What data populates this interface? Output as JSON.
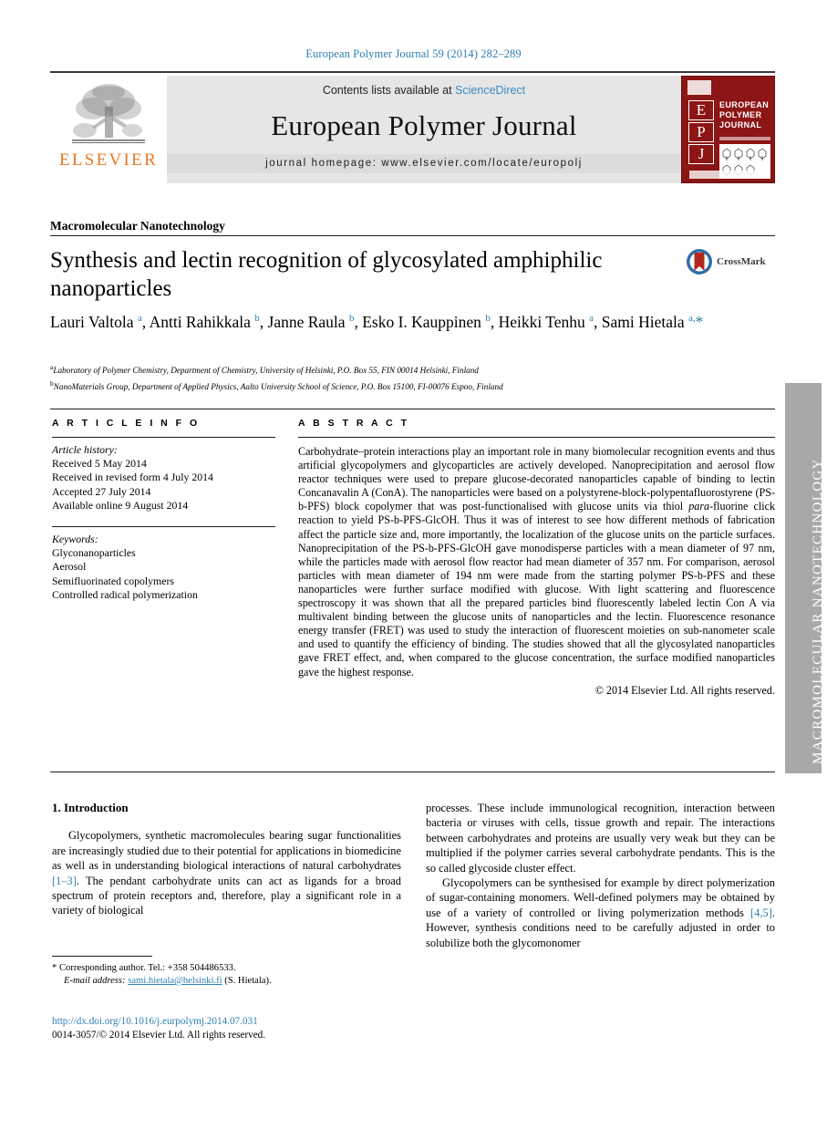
{
  "running_head": "European Polymer Journal 59 (2014) 282–289",
  "masthead": {
    "contents_prefix": "Contents lists available at ",
    "sciencedirect": "ScienceDirect",
    "journal_name": "European Polymer Journal",
    "homepage": "journal homepage: www.elsevier.com/locate/europolj",
    "publisher_wordmark": "ELSEVIER",
    "cover": {
      "letters": [
        "E",
        "P",
        "J"
      ],
      "title": "EUROPEAN POLYMER JOURNAL"
    }
  },
  "section_label": "Macromolecular Nanotechnology",
  "title": "Synthesis and lectin recognition of glycosylated amphiphilic nanoparticles",
  "crossmark_label": "CrossMark",
  "authors_html": "Lauri Valtola <sup>a</sup>, Antti Rahikkala <sup>b</sup>, Janne Raula <sup>b</sup>, Esko I. Kauppinen <sup>b</sup>, Heikki Tenhu <sup>a</sup>, Sami Hietala <sup>a,</sup><span class=\"star\">*</span>",
  "affiliations": [
    "Laboratory of Polymer Chemistry, Department of Chemistry, University of Helsinki, P.O. Box 55, FIN 00014 Helsinki, Finland",
    "NanoMaterials Group, Department of Applied Physics, Aalto University School of Science, P.O. Box 15100, FI-00076 Espoo, Finland"
  ],
  "affiliation_marks": [
    "a",
    "b"
  ],
  "article_info": {
    "heading": "A R T I C L E   I N F O",
    "history_label": "Article history:",
    "history": [
      "Received 5 May 2014",
      "Received in revised form 4 July 2014",
      "Accepted 27 July 2014",
      "Available online 9 August 2014"
    ],
    "keywords_label": "Keywords:",
    "keywords": [
      "Glyconanoparticles",
      "Aerosol",
      "Semifluorinated copolymers",
      "Controlled radical polymerization"
    ]
  },
  "abstract": {
    "heading": "A B S T R A C T",
    "paragraph_1": "Carbohydrate–protein interactions play an important role in many biomolecular recognition events and thus artificial glycopolymers and glycoparticles are actively developed. Nanoprecipitation and aerosol flow reactor techniques were used to prepare glucose-decorated nanoparticles capable of binding to lectin Concanavalin A (ConA). The nanoparticles were based on a polystyrene-block-polypentafluorostyrene (PS-b-PFS) block copolymer that was post-functionalised with glucose units via thiol ",
    "italic_term": "para",
    "paragraph_2": "-fluorine click reaction to yield PS-b-PFS-GlcOH. Thus it was of interest to see how different methods of fabrication affect the particle size and, more importantly, the localization of the glucose units on the particle surfaces. Nanoprecipitation of the PS-b-PFS-GlcOH gave monodisperse particles with a mean diameter of 97 nm, while the particles made with aerosol flow reactor had mean diameter of 357 nm. For comparison, aerosol particles with mean diameter of 194 nm were made from the starting polymer PS-b-PFS and these nanoparticles were further surface modified with glucose. With light scattering and fluorescence spectroscopy it was shown that all the prepared particles bind fluorescently labeled lectin Con A via multivalent binding between the glucose units of nanoparticles and the lectin. Fluorescence resonance energy transfer (FRET) was used to study the interaction of fluorescent moieties on sub-nanometer scale and used to quantify the efficiency of binding. The studies showed that all the glycosylated nanoparticles gave FRET effect, and, when compared to the glucose concentration, the surface modified nanoparticles gave the highest response.",
    "copyright": "© 2014 Elsevier Ltd. All rights reserved."
  },
  "side_tab": "MACROMOLECULAR NANOTECHNOLOGY",
  "body": {
    "intro_heading": "1. Introduction",
    "left_p1_a": "Glycopolymers, synthetic macromolecules bearing sugar functionalities are increasingly studied due to their potential for applications in biomedicine as well as in understanding biological interactions of natural carbohydrates ",
    "left_p1_ref": "[1–3]",
    "left_p1_b": ". The pendant carbohydrate units can act as ligands for a broad spectrum of protein receptors and, therefore, play a significant role in a variety of biological",
    "right_p1": "processes. These include immunological recognition, interaction between bacteria or viruses with cells, tissue growth and repair. The interactions between carbohydrates and proteins are usually very weak but they can be multiplied if the polymer carries several carbohydrate pendants. This is the so called glycoside cluster effect.",
    "right_p2_a": "Glycopolymers can be synthesised for example by direct polymerization of sugar-containing monomers. Well-defined polymers may be obtained by use of a variety of controlled or living polymerization methods ",
    "right_p2_ref": "[4,5]",
    "right_p2_b": ". However, synthesis conditions need to be carefully adjusted in order to solubilize both the glycomonomer"
  },
  "footnote": {
    "star": "*",
    "corresponding": "Corresponding author. Tel.: +358 504486533.",
    "email_label": "E-mail address:",
    "email": "sami.hietala@helsinki.fi",
    "email_owner": "(S. Hietala)."
  },
  "doi": "http://dx.doi.org/10.1016/j.eurpolymj.2014.07.031",
  "issn_line": "0014-3057/© 2014 Elsevier Ltd. All rights reserved.",
  "colors": {
    "link_blue": "#2f7fb5",
    "elsevier_orange": "#e87722",
    "cover_red": "#8c1515",
    "side_tab_gray": "#a8a8a8"
  }
}
